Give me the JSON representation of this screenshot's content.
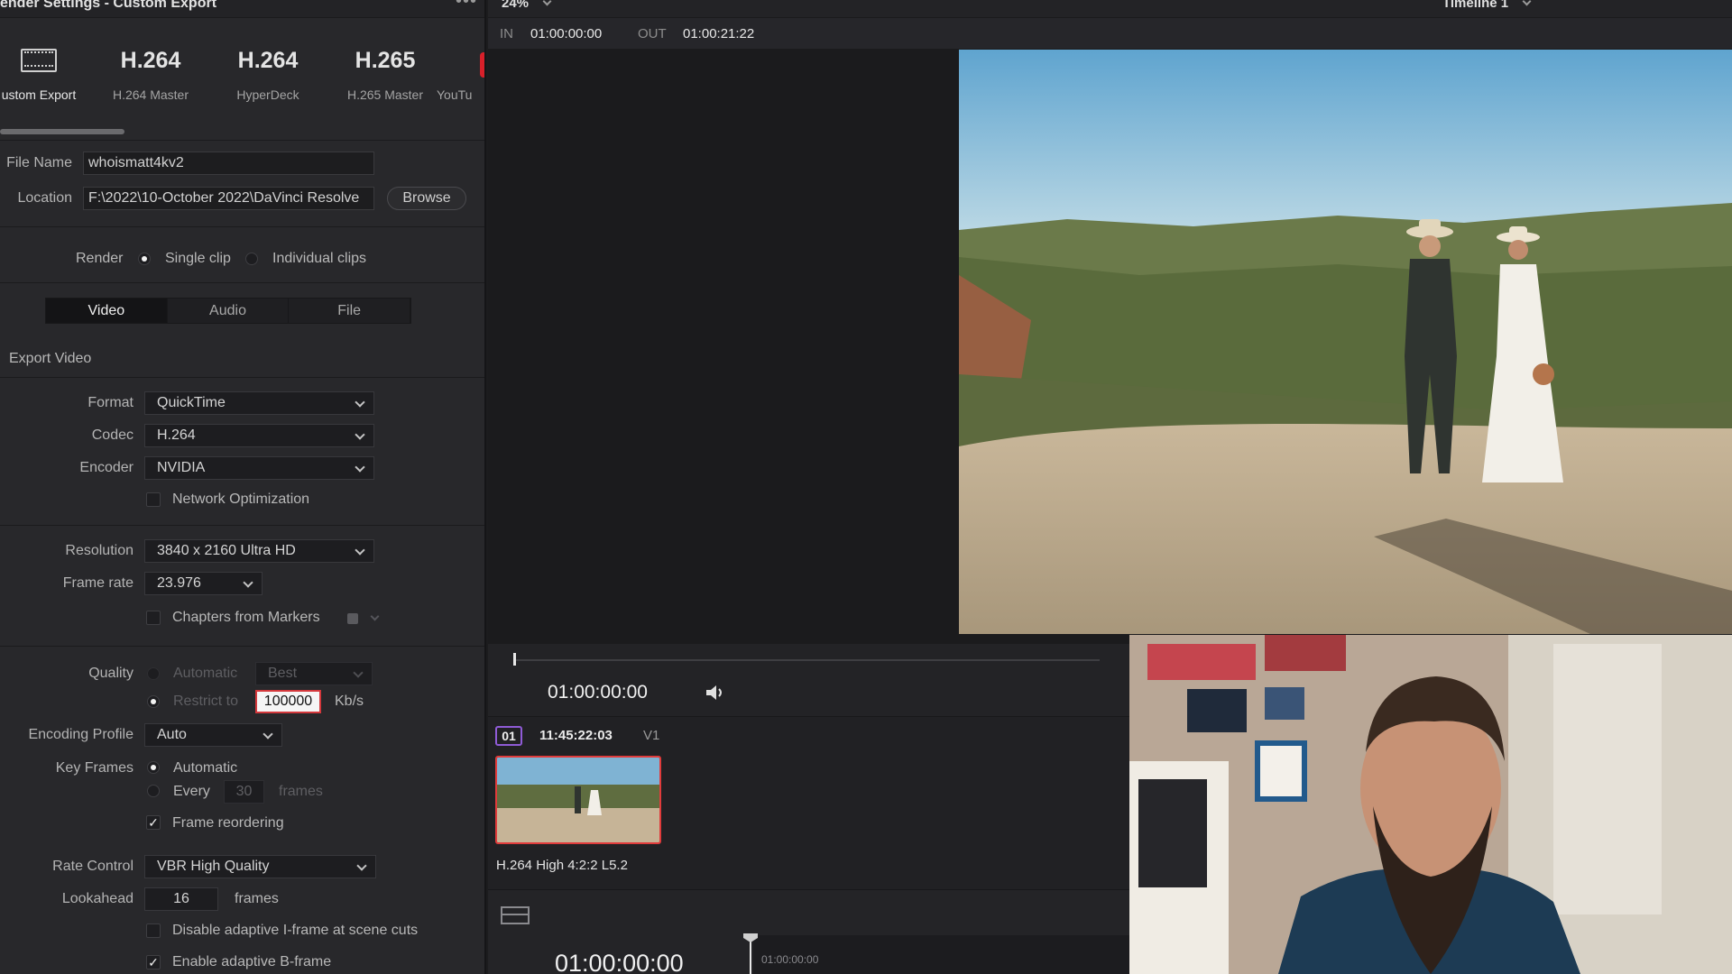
{
  "panel": {
    "title": "ender Settings - Custom Export",
    "more": "•••"
  },
  "presets": [
    {
      "big": "",
      "label": "ustom Export",
      "icon": "film-strip-icon",
      "selected": true
    },
    {
      "big": "H.264",
      "label": "H.264 Master"
    },
    {
      "big": "H.264",
      "label": "HyperDeck"
    },
    {
      "big": "H.265",
      "label": "H.265 Master"
    },
    {
      "big": "",
      "label": "YouTu"
    }
  ],
  "file": {
    "name_label": "File Name",
    "name_value": "whoismatt4kv2",
    "location_label": "Location",
    "location_value": "F:\\2022\\10-October 2022\\DaVinci Resolve",
    "browse": "Browse"
  },
  "render": {
    "label": "Render",
    "single": "Single clip",
    "individual": "Individual clips"
  },
  "tabs": [
    "Video",
    "Audio",
    "File"
  ],
  "export_video_label": "Export Video",
  "video": {
    "format_label": "Format",
    "format": "QuickTime",
    "codec_label": "Codec",
    "codec": "H.264",
    "encoder_label": "Encoder",
    "encoder": "NVIDIA",
    "network_opt": "Network Optimization",
    "resolution_label": "Resolution",
    "resolution": "3840 x 2160 Ultra HD",
    "framerate_label": "Frame rate",
    "framerate": "23.976",
    "chapters": "Chapters from Markers",
    "quality_label": "Quality",
    "quality_auto": "Automatic",
    "quality_best": "Best",
    "restrict_label": "Restrict to",
    "restrict_value": "100000",
    "restrict_unit": "Kb/s",
    "profile_label": "Encoding Profile",
    "profile": "Auto",
    "keyframes_label": "Key Frames",
    "kf_auto": "Automatic",
    "kf_every": "Every",
    "kf_every_value": "30",
    "kf_unit": "frames",
    "frame_reordering": "Frame reordering",
    "rate_control_label": "Rate Control",
    "rate_control": "VBR High Quality",
    "lookahead_label": "Lookahead",
    "lookahead_value": "16",
    "lookahead_unit": "frames",
    "disable_iframe": "Disable adaptive I-frame at scene cuts",
    "enable_bframe": "Enable adaptive B-frame"
  },
  "viewer": {
    "zoom": "24%",
    "timeline": "Timeline 1",
    "in_label": "IN",
    "in_tc": "01:00:00:00",
    "out_label": "OUT",
    "out_tc": "01:00:21:22",
    "timecode": "01:00:00:00"
  },
  "clip": {
    "index": "01",
    "tc": "11:45:22:03",
    "track": "V1",
    "codec_name": "H.264 High 4:2:2 L5.2"
  },
  "timeline": {
    "timecode": "01:00:00:00",
    "ruler_tc": "01:00:00:00"
  },
  "colors": {
    "accent_red": "#d8202a",
    "clip_badge": "#8f5bd6",
    "selected_clip_border": "#e03b3b"
  }
}
